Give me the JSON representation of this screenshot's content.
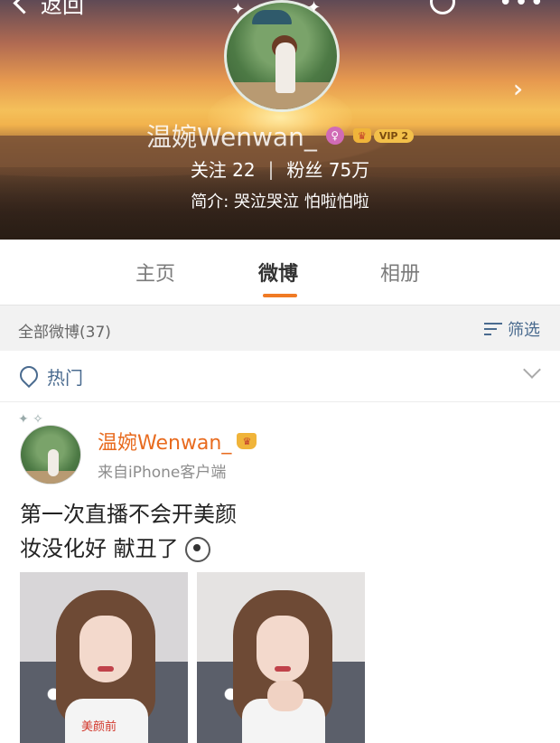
{
  "header": {
    "back_label": "返回",
    "profile": {
      "name": "温婉Wenwan_",
      "vip_label": "VIP 2",
      "following_label": "关注",
      "following_count": "22",
      "separator": "|",
      "followers_label": "粉丝",
      "followers_count": "75万",
      "bio": "简介: 哭泣哭泣 怕啦怕啦"
    }
  },
  "tabs": [
    {
      "label": "主页",
      "active": false
    },
    {
      "label": "微博",
      "active": true
    },
    {
      "label": "相册",
      "active": false
    }
  ],
  "filter_bar": {
    "all_posts_label": "全部微博(37)",
    "filter_label": "筛选"
  },
  "hot_row": {
    "label": "热门"
  },
  "post": {
    "author": "温婉Wenwan_",
    "source": "来自iPhone客户端",
    "text_line1": "第一次直播不会开美颜",
    "text_line2": "妆没化好 献丑了",
    "photo1_caption": "美颜前"
  },
  "colors": {
    "accent": "#f07a24",
    "link": "#4a6b8f",
    "author_name": "#e86b1f"
  }
}
